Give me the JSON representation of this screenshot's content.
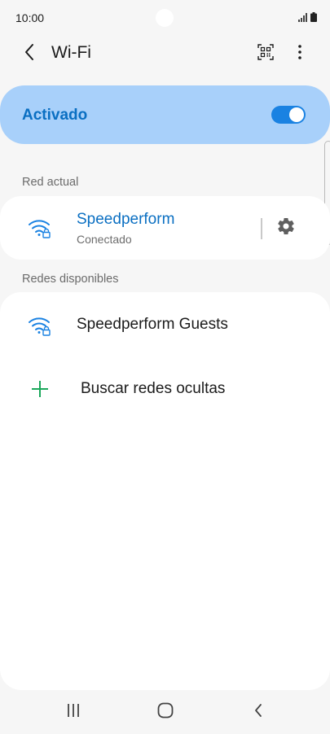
{
  "status_bar": {
    "time": "10:00",
    "signal_icon": "signal-icon",
    "battery_icon": "battery-icon"
  },
  "appbar": {
    "title": "Wi-Fi",
    "back_icon": "back-arrow-icon",
    "qr_icon": "qr-code-icon",
    "more_icon": "more-vert-icon"
  },
  "master_switch": {
    "label": "Activado",
    "state": "on"
  },
  "current_network": {
    "header": "Red actual",
    "name": "Speedperform",
    "status": "Conectado",
    "icon": "wifi-lock-icon",
    "settings_icon": "gear-icon"
  },
  "available_networks": {
    "header": "Redes disponibles",
    "items": [
      {
        "name": "Speedperform Guests",
        "icon": "wifi-lock-icon"
      }
    ],
    "add_hidden": {
      "label": "Buscar redes ocultas",
      "icon": "plus-icon"
    }
  },
  "colors": {
    "accent": "#0a6fc2",
    "toggle": "#1a82e2",
    "master_bg": "#a8d0fa",
    "add_icon": "#1ba85b",
    "background": "#f6f6f6"
  },
  "navbar": {
    "recents_icon": "recents-icon",
    "home_icon": "home-icon",
    "back_icon": "back-icon"
  }
}
